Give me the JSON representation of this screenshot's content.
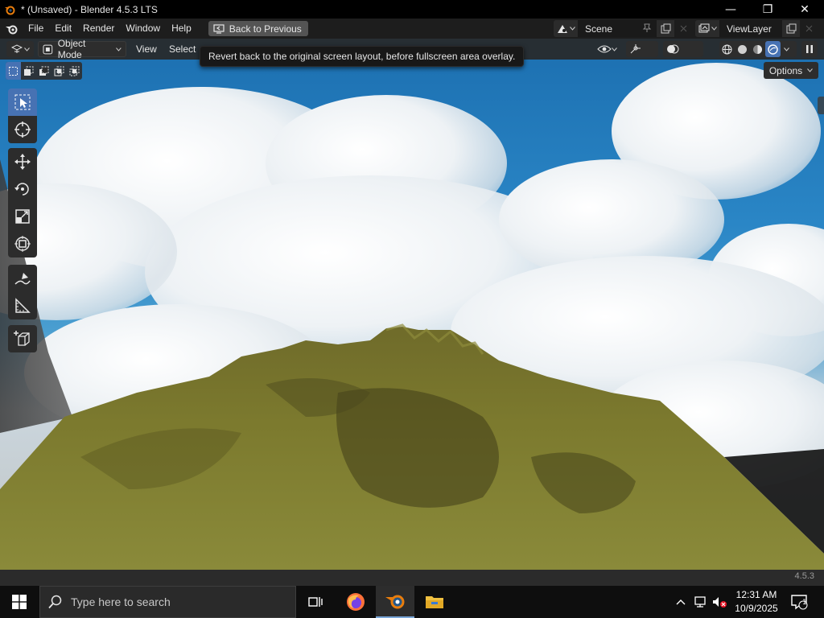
{
  "window": {
    "title": "* (Unsaved) - Blender 4.5.3 LTS",
    "minimize": "—",
    "maximize": "❐",
    "close": "✕"
  },
  "menubar": {
    "items": [
      "File",
      "Edit",
      "Render",
      "Window",
      "Help"
    ],
    "back_button": "Back to Previous",
    "scene": "Scene",
    "view_layer": "ViewLayer"
  },
  "viewport_header": {
    "mode": "Object Mode",
    "menus": [
      "View",
      "Select"
    ],
    "tooltip": "Revert back to the original screen layout, before fullscreen area overlay.",
    "options": "Options",
    "active_shading": "rendered"
  },
  "toolbar": {
    "tools": [
      "select-box",
      "cursor",
      "move",
      "rotate",
      "scale",
      "transform",
      "annotate",
      "measure",
      "add-cube"
    ],
    "active_tool": "select-box"
  },
  "statusbar": {
    "version": "4.5.3"
  },
  "taskbar": {
    "search_placeholder": "Type here to search",
    "apps": [
      "task-view",
      "firefox",
      "blender",
      "file-explorer"
    ],
    "active_app": "blender",
    "time": "12:31 AM",
    "date": "10/9/2025",
    "notifications": "1"
  },
  "colors": {
    "accent": "#4772b3",
    "terrain": "#7a7a2a",
    "sky": "#2a86c6"
  }
}
